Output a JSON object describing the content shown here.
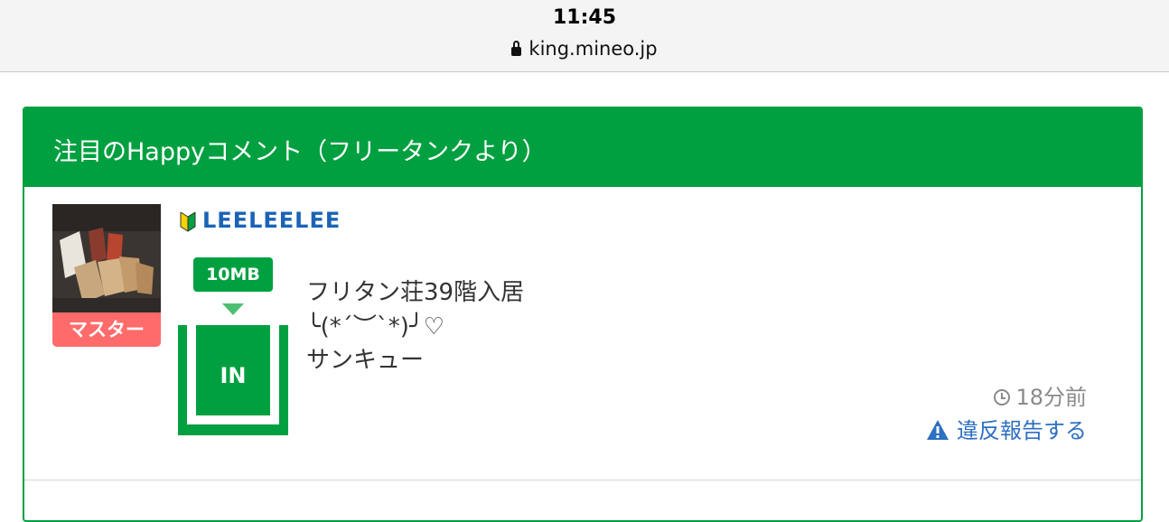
{
  "browser": {
    "time": "11:45",
    "url": "king.mineo.jp"
  },
  "section": {
    "title": "注目のHappyコメント（フリータンクより）"
  },
  "comment": {
    "user": {
      "name": "LEELEELEE",
      "badge": "マスター"
    },
    "tank": {
      "amount": "10MB",
      "direction": "IN"
    },
    "text_lines": [
      "フリタン荘39階入居",
      "╰(*´︶`*)╯♡",
      "サンキュー"
    ],
    "posted_time": "18分前",
    "report_label": "違反報告する"
  },
  "colors": {
    "brand_green": "#00a040",
    "link_blue": "#2d6fc2",
    "badge_red": "#ff6b6b"
  }
}
